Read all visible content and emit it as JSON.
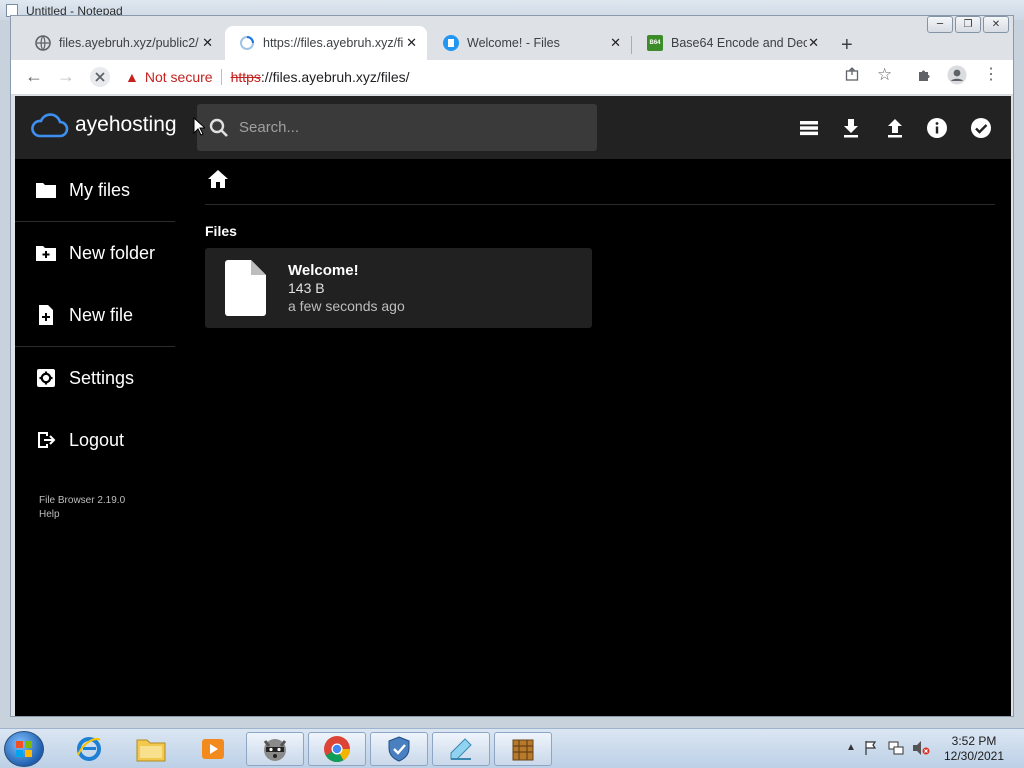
{
  "background_window": {
    "title": "Untitled - Notepad"
  },
  "browser": {
    "tabs": [
      {
        "label": "files.ayebruh.xyz/public2/",
        "active": false
      },
      {
        "label": "https://files.ayebruh.xyz/fi",
        "active": true
      },
      {
        "label": "Welcome! - Files",
        "active": false
      },
      {
        "label": "Base64 Encode and Deco",
        "active": false
      }
    ],
    "new_tab_label": "+",
    "security_label": "Not secure",
    "url_scheme": "https",
    "url_rest": "://files.ayebruh.xyz/files/"
  },
  "app": {
    "brand": "ayehosting",
    "search_placeholder": "Search...",
    "sidebar": {
      "items": [
        {
          "label": "My files"
        },
        {
          "label": "New folder"
        },
        {
          "label": "New file"
        },
        {
          "label": "Settings"
        },
        {
          "label": "Logout"
        }
      ]
    },
    "footer": {
      "version": "File Browser 2.19.0",
      "help": "Help"
    },
    "section_title": "Files",
    "files": [
      {
        "name": "Welcome!",
        "size": "143 B",
        "modified": "a few seconds ago"
      }
    ]
  },
  "taskbar": {
    "time": "3:52 PM",
    "date": "12/30/2021"
  },
  "colors": {
    "app_bg": "#000000",
    "header_bg": "#222222",
    "accent_blue": "#2196f3",
    "warning_red": "#c5221f"
  }
}
